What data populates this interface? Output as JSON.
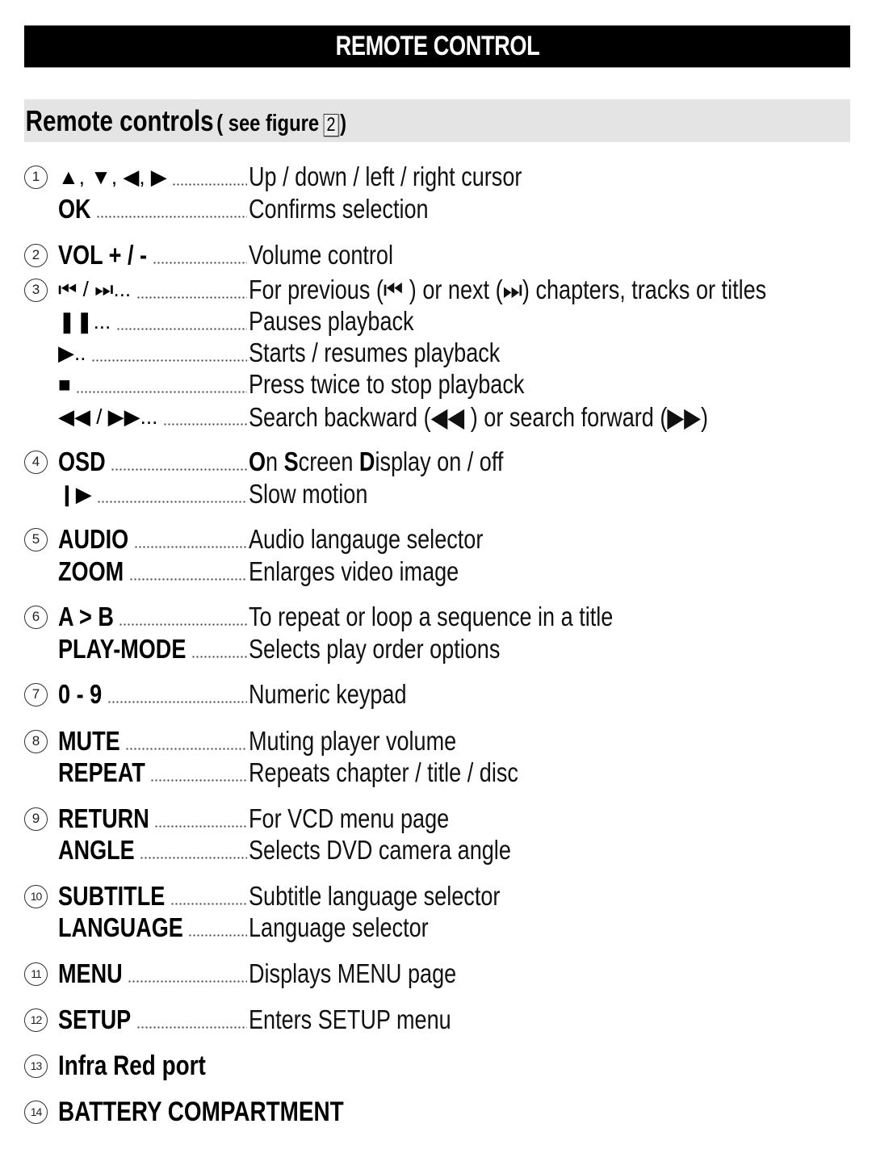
{
  "header": {
    "title": "REMOTE CONTROL"
  },
  "section": {
    "title": "Remote controls",
    "sub_prefix": "( see figure",
    "figure_number": "2",
    "sub_suffix": ")"
  },
  "items": [
    {
      "number": "1",
      "entries": [
        {
          "key": "▲, ▼, ◀, ▶",
          "key_type": "symbol",
          "icons": [
            "up-arrow-icon",
            "down-arrow-icon",
            "left-arrow-icon",
            "right-arrow-icon"
          ],
          "description": "Up / down / left / right cursor"
        },
        {
          "key": "OK",
          "key_type": "text",
          "description": "Confirms selection"
        }
      ]
    },
    {
      "number": "2",
      "entries": [
        {
          "key": "VOL + / -",
          "key_type": "text",
          "description": "Volume control"
        }
      ]
    },
    {
      "number": "3",
      "entries": [
        {
          "key": "⏮ /  ⏭...",
          "key_type": "symbol",
          "icons": [
            "previous-icon",
            "next-icon"
          ],
          "description": "For previous (⏮ ) or next (⏭) chapters, tracks or titles"
        },
        {
          "key": "❚❚...",
          "key_type": "symbol",
          "icons": [
            "pause-icon"
          ],
          "description": "Pauses playback"
        },
        {
          "key": "▶..",
          "key_type": "symbol",
          "icons": [
            "play-icon"
          ],
          "description": "Starts / resumes playback"
        },
        {
          "key": "■",
          "key_type": "symbol",
          "icons": [
            "stop-icon"
          ],
          "description": "Press twice to stop playback"
        },
        {
          "key": "◀◀ / ▶▶...",
          "key_type": "symbol",
          "icons": [
            "rewind-icon",
            "fast-forward-icon"
          ],
          "description": "Search backward (◀◀  ) or search forward (▶▶)"
        }
      ]
    },
    {
      "number": "4",
      "entries": [
        {
          "key": "OSD",
          "key_type": "text",
          "description_parts": [
            {
              "text": "O",
              "bold": true
            },
            {
              "text": "n ",
              "bold": false
            },
            {
              "text": "S",
              "bold": true
            },
            {
              "text": "creen ",
              "bold": false
            },
            {
              "text": "D",
              "bold": true
            },
            {
              "text": "isplay on / off",
              "bold": false
            }
          ],
          "description": "On Screen Display on / off"
        },
        {
          "key": "❙▶",
          "key_type": "symbol",
          "icons": [
            "slow-motion-icon"
          ],
          "description": "Slow motion"
        }
      ]
    },
    {
      "number": "5",
      "entries": [
        {
          "key": "AUDIO",
          "key_type": "text",
          "description": "Audio langauge selector"
        },
        {
          "key": "ZOOM",
          "key_type": "text",
          "description": "Enlarges video image"
        }
      ]
    },
    {
      "number": "6",
      "entries": [
        {
          "key": "A > B",
          "key_type": "text",
          "description": "To repeat or loop a sequence in a title"
        },
        {
          "key": "PLAY-MODE",
          "key_type": "text",
          "description": "Selects play order options"
        }
      ]
    },
    {
      "number": "7",
      "entries": [
        {
          "key": "0 - 9",
          "key_type": "text",
          "description": "Numeric keypad"
        }
      ]
    },
    {
      "number": "8",
      "entries": [
        {
          "key": "MUTE",
          "key_type": "text",
          "description": "Muting player volume"
        },
        {
          "key": "REPEAT",
          "key_type": "text",
          "description": "Repeats chapter / title / disc"
        }
      ]
    },
    {
      "number": "9",
      "entries": [
        {
          "key": "RETURN",
          "key_type": "text",
          "description": "For VCD menu page"
        },
        {
          "key": "ANGLE",
          "key_type": "text",
          "description": "Selects DVD camera angle"
        }
      ]
    },
    {
      "number": "10",
      "entries": [
        {
          "key": "SUBTITLE",
          "key_type": "text",
          "description": "Subtitle language selector"
        },
        {
          "key": "LANGUAGE",
          "key_type": "text",
          "description": "Language selector"
        }
      ]
    },
    {
      "number": "11",
      "entries": [
        {
          "key": "MENU",
          "key_type": "text",
          "description": "Displays MENU page"
        }
      ]
    },
    {
      "number": "12",
      "entries": [
        {
          "key": "SETUP",
          "key_type": "text",
          "description": "Enters SETUP menu"
        }
      ]
    },
    {
      "number": "13",
      "entries": [
        {
          "key": "Infra Red port",
          "key_type": "heading"
        }
      ]
    },
    {
      "number": "14",
      "entries": [
        {
          "key": "BATTERY COMPARTMENT",
          "key_type": "heading"
        }
      ]
    }
  ]
}
